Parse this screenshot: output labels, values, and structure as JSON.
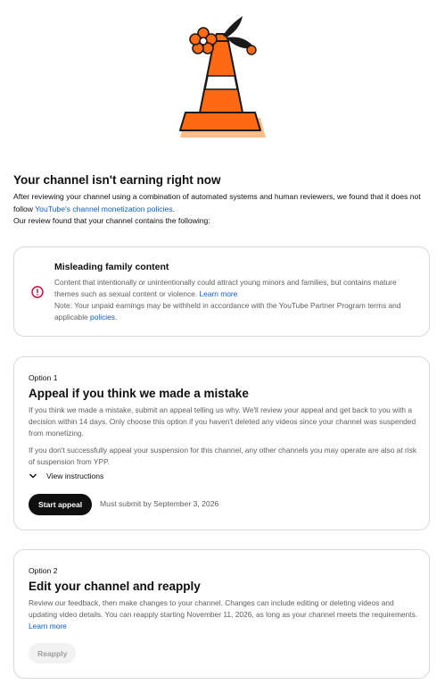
{
  "header": {
    "title": "Your channel isn't earning right now",
    "intro_line1_before": "After reviewing your channel using a combination of automated systems and human reviewers, we found that it does not follow ",
    "intro_link": "YouTube's channel monetization policies",
    "intro_line1_after": ".",
    "intro_line2": "Our review found that your channel contains the following:"
  },
  "finding": {
    "icon": "alert-circle-icon",
    "heading": "Misleading family content",
    "description": "Content that intentionally or unintentionally could attract young minors and families, but contains mature themes such as sexual content or violence.",
    "learn_more": "Learn more",
    "note_before": "Note: Your unpaid earnings may be withheld in accordance with the YouTube Partner Program terms and applicable ",
    "note_link": "policies",
    "note_after": "."
  },
  "option1": {
    "label": "Option 1",
    "title": "Appeal if you think we made a mistake",
    "para1": "If you think we made a mistake, submit an appeal telling us why. We'll review your appeal and get back to you with a decision within 14 days. Only choose this option if you haven't deleted any videos since your channel was suspended from monetizing.",
    "para2": "If you don't successfully appeal your suspension for this channel, any other channels you may operate are also at risk of suspension from YPP.",
    "instructions_label": "View instructions",
    "button_label": "Start appeal",
    "deadline": "Must submit by September 3, 2026"
  },
  "option2": {
    "label": "Option 2",
    "title": "Edit your channel and reapply",
    "body": "Review our feedback, then make changes to your channel. Changes can include editing or deleting videos and updating video details. You can reapply starting November 11, 2026, as long as your channel meets the requirements.",
    "learn_more": "Learn more",
    "button_label": "Reapply"
  },
  "colors": {
    "accent_link": "#065fd4",
    "alert_red": "#cc0033",
    "cone_orange": "#ff6a13",
    "cone_outline_peach": "#ffbd8c"
  }
}
